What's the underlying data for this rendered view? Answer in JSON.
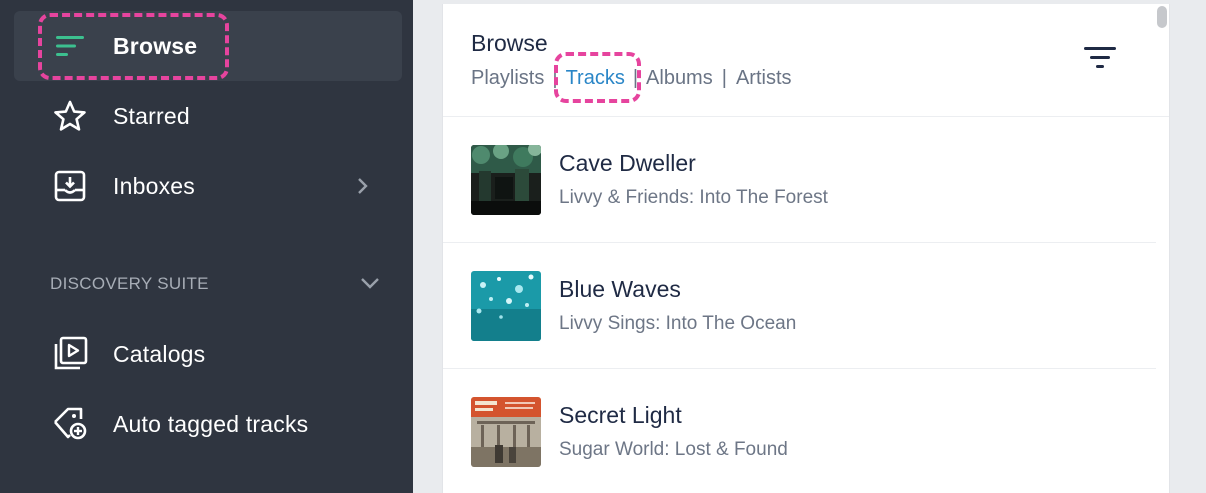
{
  "sidebar": {
    "items": [
      {
        "label": "Browse",
        "icon": "browse-lines-icon",
        "active": true
      },
      {
        "label": "Starred",
        "icon": "star-icon"
      },
      {
        "label": "Inboxes",
        "icon": "inbox-download-icon"
      },
      {
        "label": "Catalogs",
        "icon": "catalog-play-icon"
      },
      {
        "label": "Auto tagged tracks",
        "icon": "tag-plus-icon"
      }
    ],
    "section_label": "DISCOVERY SUITE"
  },
  "main": {
    "title": "Browse",
    "tabs": [
      {
        "label": "Playlists"
      },
      {
        "label": "Tracks",
        "active": true
      },
      {
        "label": "Albums"
      },
      {
        "label": "Artists"
      }
    ],
    "separator": "|",
    "tracks": [
      {
        "title": "Cave Dweller",
        "subtitle": "Livvy & Friends: Into The Forest"
      },
      {
        "title": "Blue Waves",
        "subtitle": "Livvy Sings: Into The Ocean"
      },
      {
        "title": "Secret Light",
        "subtitle": "Sugar World: Lost & Found"
      }
    ]
  },
  "colors": {
    "sidebar_bg": "#2f3540",
    "accent_green": "#3cc08f",
    "active_tab": "#2a86c7",
    "highlight": "#e6449e"
  }
}
